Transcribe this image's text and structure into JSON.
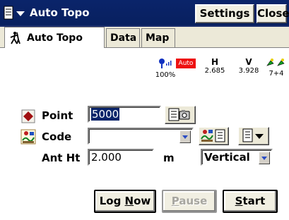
{
  "titlebar": {
    "title": "Auto Topo",
    "settings_label": "Settings",
    "close_label": "Close"
  },
  "tabs": [
    {
      "label": "Auto Topo",
      "active": true
    },
    {
      "label": "Data",
      "active": false
    },
    {
      "label": "Map",
      "active": false
    }
  ],
  "status": {
    "gps_percent": "100%",
    "mode_badge": "Auto",
    "h_label": "H",
    "h_value": "2.685",
    "v_label": "V",
    "v_value": "3.928",
    "sat_value": "7+4"
  },
  "form": {
    "point_label": "Point",
    "point_value": "5000",
    "code_label": "Code",
    "code_value": "",
    "ant_ht_label": "Ant Ht",
    "ant_ht_value": "2.000",
    "ant_ht_unit": "m",
    "ant_ht_type": "Vertical"
  },
  "buttons": {
    "log_now_pre": "Log ",
    "log_now_u": "N",
    "log_now_post": "ow",
    "pause_pre": "",
    "pause_u": "P",
    "pause_post": "ause",
    "start_pre": "",
    "start_u": "S",
    "start_post": "tart"
  },
  "colors": {
    "titlebar": "#0a246a",
    "auto_badge": "#ee1111",
    "selection": "#0a246a"
  }
}
